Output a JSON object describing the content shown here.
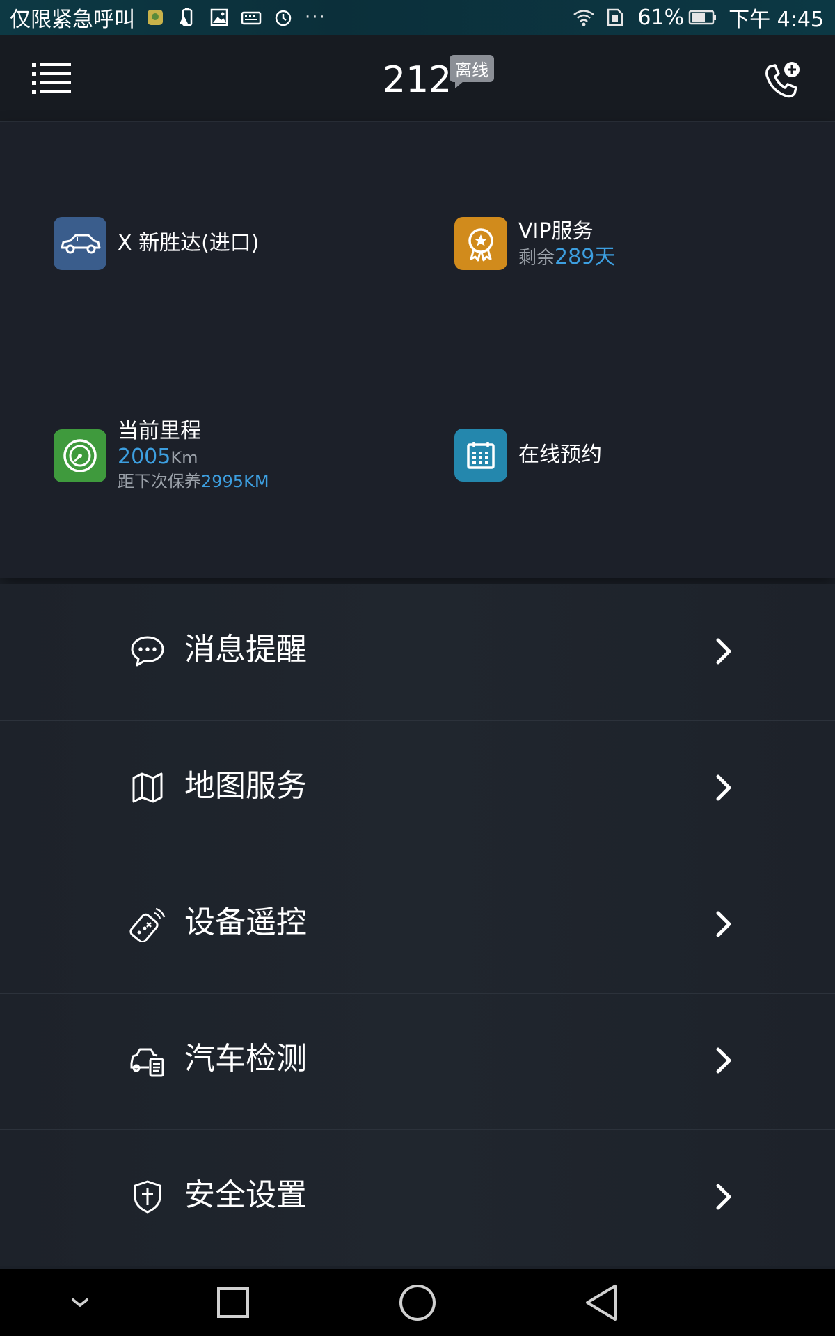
{
  "status_bar": {
    "left_text": "仅限紧急呼叫",
    "notification_icons": [
      "app-icon",
      "battery-warning-icon",
      "image-icon",
      "keyboard-icon",
      "alarm-icon"
    ],
    "more": "···",
    "battery_percent": "61%",
    "time": "下午 4:45"
  },
  "header": {
    "title": "212",
    "status_badge": "离线"
  },
  "grid": {
    "car": {
      "label": "X 新胜达(进口)",
      "icon": "car-icon",
      "color": "#3a5d8c"
    },
    "vip": {
      "label": "VIP服务",
      "remaining_prefix": "剩余",
      "remaining_value": "289天",
      "icon": "vip-medal-icon",
      "color": "#d18b1c"
    },
    "mileage": {
      "label": "当前里程",
      "value": "2005",
      "unit": "Km",
      "next_prefix": "距下次保养",
      "next_value": "2995KM",
      "icon": "speedometer-icon",
      "color": "#3f9a3d"
    },
    "booking": {
      "label": "在线预约",
      "icon": "calendar-icon",
      "color": "#2487ad"
    }
  },
  "menu": [
    {
      "label": "消息提醒",
      "icon": "message-bubble-icon"
    },
    {
      "label": "地图服务",
      "icon": "map-icon"
    },
    {
      "label": "设备遥控",
      "icon": "remote-key-icon"
    },
    {
      "label": "汽车检测",
      "icon": "car-diagnostics-icon"
    },
    {
      "label": "安全设置",
      "icon": "shield-icon"
    }
  ],
  "accent_color": "#3d9fe0"
}
